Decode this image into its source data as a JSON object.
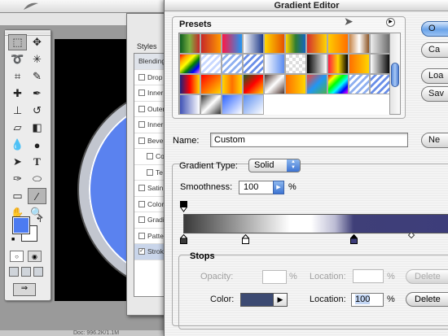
{
  "gradient_editor": {
    "title": "Gradient Editor",
    "presets_label": "Presets",
    "buttons": {
      "ok": "O",
      "cancel": "Ca",
      "load": "Loa",
      "save": "Sav",
      "new": "Ne"
    },
    "name_label": "Name:",
    "name_value": "Custom",
    "gradient_type_label": "Gradient Type:",
    "gradient_type_value": "Solid",
    "smoothness_label": "Smoothness:",
    "smoothness_value": "100",
    "smoothness_unit": "%",
    "stops": {
      "label": "Stops",
      "opacity_label": "Opacity:",
      "opacity_unit": "%",
      "opacity_location_label": "Location:",
      "opacity_location_unit": "%",
      "delete_top": "Delete",
      "color_label": "Color:",
      "color_value": "#3c4a72",
      "location_label": "Location:",
      "location_value": "100",
      "location_unit": "%",
      "delete_bottom": "Delete"
    },
    "presets": [
      [
        "#1e7d2f",
        "#e84a0c",
        "#ff1744",
        "#ffffff",
        "#ffd600",
        "#ffd600",
        "#d32f2f",
        "#ffcc00",
        "#c8874a",
        "#9e9e9e"
      ],
      [
        "#ff0000",
        "#e8f0ff",
        "#e8f0ff",
        "#e8f0ff",
        "#ffffff",
        "#ffffff",
        "#000000",
        "#ff0000",
        "#ffb300",
        "#ffffff"
      ],
      [
        "#1a237e",
        "#ff0000",
        "#ffd700",
        "#2e7d32",
        "#8d6e63",
        "#ff6f00",
        "#f44336",
        "#ff1744",
        "#e8f0ff",
        "#e8f0ff"
      ],
      [
        "#3f51b5",
        "#ffffff",
        "#2962ff",
        "#5c8ef0",
        "#ffffff",
        "#ffffff",
        "#ffffff",
        "#ffffff",
        "#ffffff",
        "#ffffff"
      ]
    ]
  },
  "layer_style": {
    "styles_label": "Styles",
    "items": [
      {
        "label": "Blending",
        "checked": false,
        "header": true
      },
      {
        "label": "Drop",
        "checked": false
      },
      {
        "label": "Inner",
        "checked": false
      },
      {
        "label": "Outer",
        "checked": false
      },
      {
        "label": "Inner",
        "checked": false
      },
      {
        "label": "Bevel",
        "checked": false
      },
      {
        "label": "Co",
        "checked": false,
        "indent": true
      },
      {
        "label": "Te",
        "checked": false,
        "indent": true
      },
      {
        "label": "Satin",
        "checked": false
      },
      {
        "label": "Color",
        "checked": false
      },
      {
        "label": "Gradi",
        "checked": false
      },
      {
        "label": "Patte",
        "checked": false
      },
      {
        "label": "Strok",
        "checked": true,
        "selected": true
      }
    ]
  },
  "toolbox": {
    "tools": [
      "marquee",
      "move",
      "lasso",
      "magic-wand",
      "crop",
      "slice",
      "healing",
      "brush",
      "stamp",
      "history-brush",
      "eraser",
      "fill",
      "blur",
      "dodge",
      "path-select",
      "type",
      "pen",
      "shape",
      "notes",
      "eyedropper",
      "hand",
      "zoom"
    ],
    "foreground_color": "#4c7bf1",
    "background_color": "#ffffff"
  },
  "status_text": "Doc: 996.2K/1.1M"
}
